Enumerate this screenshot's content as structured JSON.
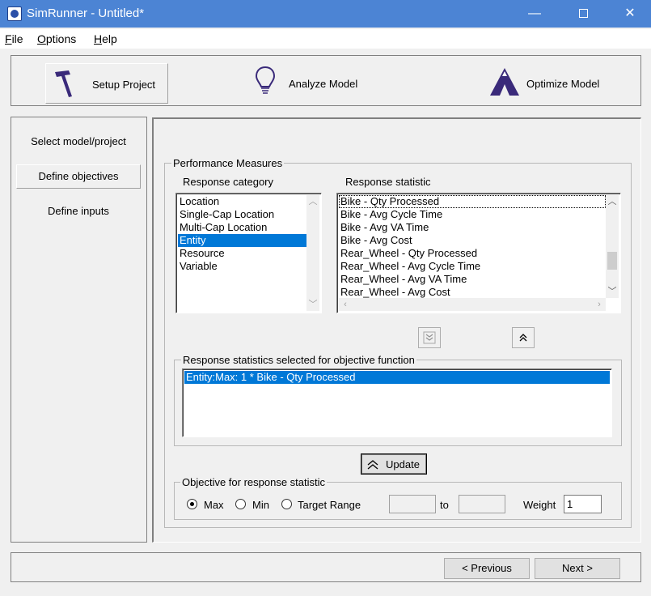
{
  "window": {
    "title": "SimRunner - Untitled*",
    "minimize_glyph": "—",
    "close_glyph": "✕"
  },
  "menu": {
    "file_key": "F",
    "file_rest": "ile",
    "options_key": "O",
    "options_rest": "ptions",
    "help_key": "H",
    "help_rest": "elp"
  },
  "toolbar": {
    "setup_project": "Setup Project",
    "analyze_model": "Analyze Model",
    "optimize_model": "Optimize Model"
  },
  "left_nav": {
    "select_model": "Select model/project",
    "define_objectives": "Define objectives",
    "define_inputs": "Define inputs"
  },
  "performance": {
    "group_title": "Performance Measures",
    "category_label": "Response category",
    "statistic_label": "Response statistic",
    "categories": [
      "Location",
      "Single-Cap Location",
      "Multi-Cap Location",
      "Entity",
      "Resource",
      "Variable"
    ],
    "selected_category_index": 3,
    "statistics": [
      "Bike - Qty Processed",
      "Bike - Avg Cycle Time",
      "Bike - Avg VA Time",
      "Bike - Avg Cost",
      "Rear_Wheel - Qty Processed",
      "Rear_Wheel - Avg Cycle Time",
      "Rear_Wheel - Avg VA Time",
      "Rear_Wheel - Avg Cost"
    ]
  },
  "selected_stats": {
    "group_title": "Response statistics selected for objective function",
    "items": [
      "Entity:Max: 1 * Bike - Qty Processed"
    ]
  },
  "update_button": "Update",
  "objective": {
    "group_title": "Objective for response statistic",
    "max_label": "Max",
    "min_label": "Min",
    "target_range_label": "Target Range",
    "to_label": "to",
    "weight_label": "Weight",
    "weight_value": "1",
    "selected": "Max"
  },
  "nav": {
    "previous": "< Previous",
    "next": "Next >"
  },
  "colors": {
    "titlebar": "#4c84d4",
    "selection": "#0078d7",
    "icon_purple": "#3a2a7a"
  }
}
